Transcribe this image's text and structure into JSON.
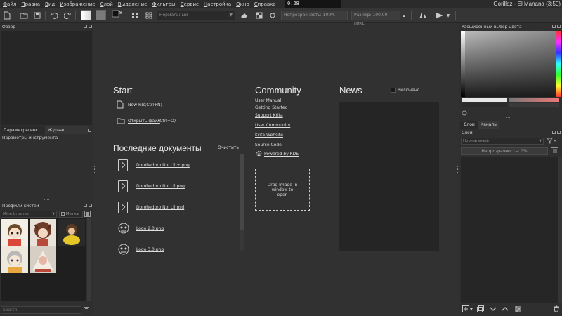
{
  "menu": [
    "Файл",
    "Правка",
    "Вид",
    "Изображение",
    "Слой",
    "Выделение",
    "Фильтры",
    "Сервис",
    "Настройка",
    "Окно",
    "Справка"
  ],
  "player": {
    "time": "0:28",
    "song": "Gorillaz - El Manana (3:50)"
  },
  "toolbar": {
    "blend_mode": "Нормальный",
    "opacity_label": "Непрозрачность: 100%",
    "size_label": "Размер: 100,00 пикс."
  },
  "left": {
    "overview_title": "Обзор",
    "tabs": [
      "Параметры инст...",
      "Журнал профилей..."
    ],
    "tool_options_title": "Параметры инструмента",
    "presets_title": "Профили кистей",
    "presets_filter": "Mine brushes",
    "tag_label": "Метка",
    "search_placeholder": "Search"
  },
  "welcome": {
    "start_heading": "Start",
    "new_file": "New File",
    "new_file_shortcut": "(Ctrl+N)",
    "open_file": "Открыть файл",
    "open_file_shortcut": "(Ctrl+O)",
    "recent_heading": "Последние документы",
    "clear_label": "Очистить",
    "recent": [
      "Dorohedoro Noi Lil +.png",
      "Dorohedoro Noi Lil.png",
      "Dorohedoro Noi Lil.psd",
      "Logo 2.0.png",
      "Logo 3.0.png"
    ],
    "community_heading": "Community",
    "community_links": [
      "User Manual",
      "Getting Started",
      "Support Krita",
      "User Community",
      "Krita Website",
      "Source Code"
    ],
    "powered_by": "Powered by KDE",
    "drag_text": "Drag Image in window to open",
    "news_heading": "News",
    "news_toggle_label": "Включено"
  },
  "right": {
    "color_title": "Расширенный выбор цвета",
    "tabs": [
      "Слои",
      "Каналы"
    ],
    "layers_title": "Слои",
    "blend_mode": "Нормальный",
    "opacity_label": "Непрозрачность: 0%"
  },
  "colors": {
    "bg": "#313131",
    "dock": "#2f2f2f",
    "panel": "#262626",
    "news_panel": "#252525"
  }
}
